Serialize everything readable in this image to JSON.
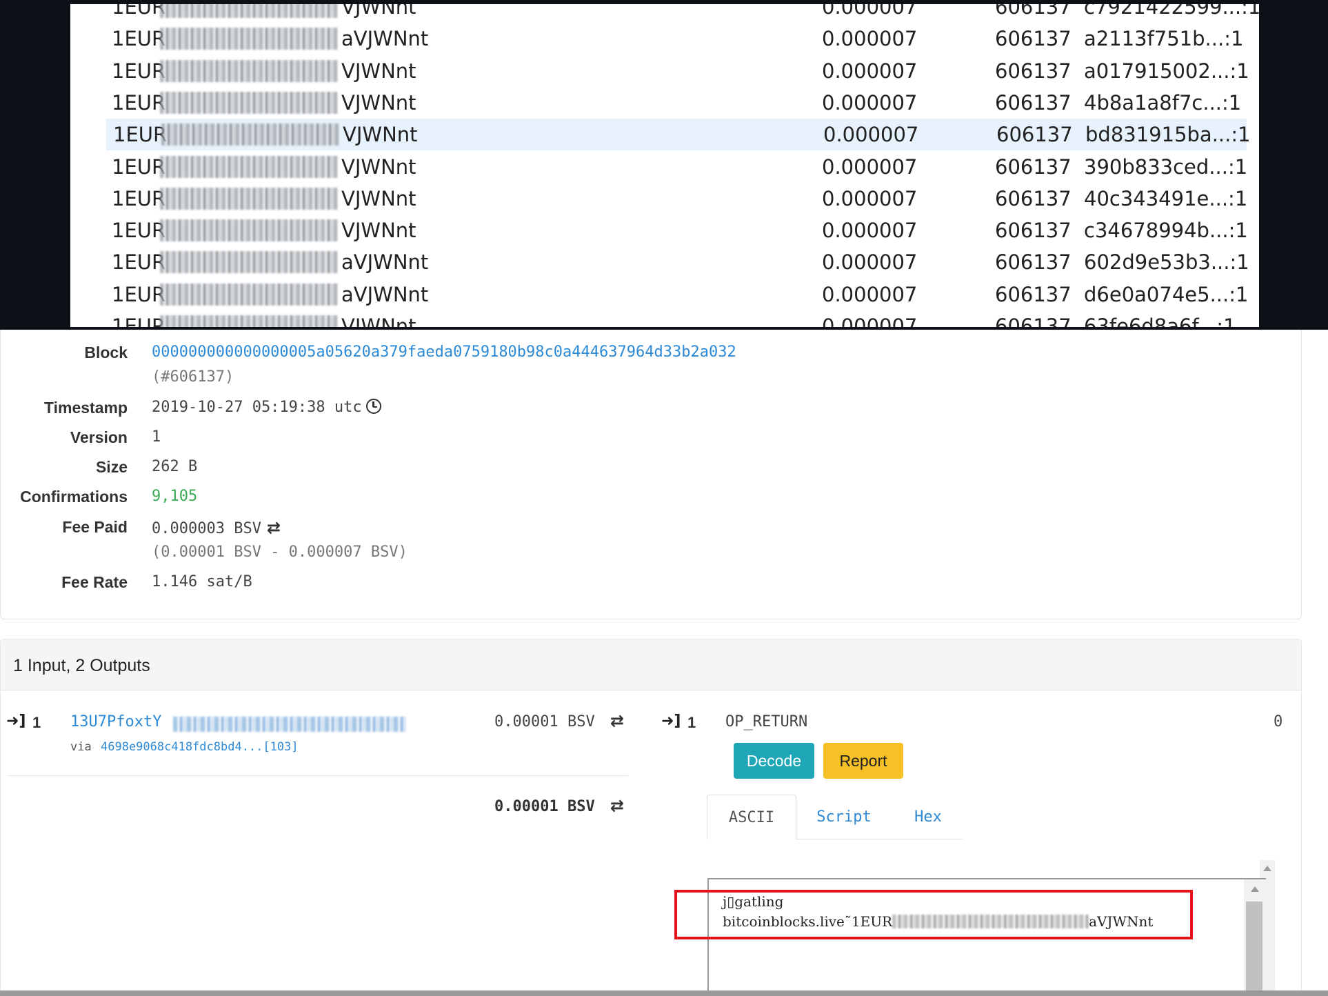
{
  "outputs_list": [
    {
      "addr_prefix": "1EUR",
      "addr_suffix": "VJWNnt",
      "amount": "0.000007",
      "block": "606137",
      "tx": "c7921422599...:1",
      "partial": "top"
    },
    {
      "addr_prefix": "1EUR",
      "addr_suffix": "aVJWNnt",
      "amount": "0.000007",
      "block": "606137",
      "tx": "a2113f751b...:1"
    },
    {
      "addr_prefix": "1EUR",
      "addr_suffix": "VJWNnt",
      "amount": "0.000007",
      "block": "606137",
      "tx": "a017915002...:1"
    },
    {
      "addr_prefix": "1EUR",
      "addr_suffix": "VJWNnt",
      "amount": "0.000007",
      "block": "606137",
      "tx": "4b8a1a8f7c...:1"
    },
    {
      "addr_prefix": "1EUR",
      "addr_suffix": "VJWNnt",
      "amount": "0.000007",
      "block": "606137",
      "tx": "bd831915ba...:1",
      "highlighted": true
    },
    {
      "addr_prefix": "1EUR",
      "addr_suffix": "VJWNnt",
      "amount": "0.000007",
      "block": "606137",
      "tx": "390b833ced...:1"
    },
    {
      "addr_prefix": "1EUR",
      "addr_suffix": "VJWNnt",
      "amount": "0.000007",
      "block": "606137",
      "tx": "40c343491e...:1"
    },
    {
      "addr_prefix": "1EUR",
      "addr_suffix": "VJWNnt",
      "amount": "0.000007",
      "block": "606137",
      "tx": "c34678994b...:1"
    },
    {
      "addr_prefix": "1EUR",
      "addr_suffix": "aVJWNnt",
      "amount": "0.000007",
      "block": "606137",
      "tx": "602d9e53b3...:1"
    },
    {
      "addr_prefix": "1EUR",
      "addr_suffix": "aVJWNnt",
      "amount": "0.000007",
      "block": "606137",
      "tx": "d6e0a074e5...:1"
    },
    {
      "addr_prefix": "1EUR",
      "addr_suffix": "VJWNnt",
      "amount": "0.000007",
      "block": "606137",
      "tx": "63fe6d8a6f...:1",
      "partial": "bottom"
    }
  ],
  "details": {
    "block_label": "Block",
    "block_hash": "000000000000000005a05620a379faeda0759180b98c0a444637964d33b2a032",
    "block_height": "(#606137)",
    "timestamp_label": "Timestamp",
    "timestamp": "2019-10-27 05:19:38 utc",
    "version_label": "Version",
    "version": "1",
    "size_label": "Size",
    "size": "262 B",
    "confirmations_label": "Confirmations",
    "confirmations": "9,105",
    "fee_paid_label": "Fee Paid",
    "fee_paid": "0.000003 BSV",
    "fee_breakdown": "(0.00001 BSV - 0.000007 BSV)",
    "fee_rate_label": "Fee Rate",
    "fee_rate": "1.146 sat/B"
  },
  "io": {
    "title": "1 Input, 2 Outputs",
    "input": {
      "index": "1",
      "address_prefix": "13U7PfoxtY",
      "via_label": "via",
      "via_tx": "4698e9068c418fdc8bd4...[103]",
      "amount": "0.00001 BSV",
      "total": "0.00001 BSV"
    },
    "output": {
      "index": "1",
      "type": "OP_RETURN",
      "value": "0",
      "decode_label": "Decode",
      "report_label": "Report",
      "tabs": [
        "ASCII",
        "Script",
        "Hex"
      ],
      "ascii_line1": "j▯gatling",
      "ascii_line2_prefix": "bitcoinblocks.live˜1EUR",
      "ascii_line2_suffix": "aVJWNnt"
    }
  },
  "colors": {
    "link": "#2d8ad6",
    "confirmations": "#3cab55",
    "decode_button": "#1fa7b8",
    "report_button": "#f6c027",
    "highlight_box": "#e3131b"
  }
}
